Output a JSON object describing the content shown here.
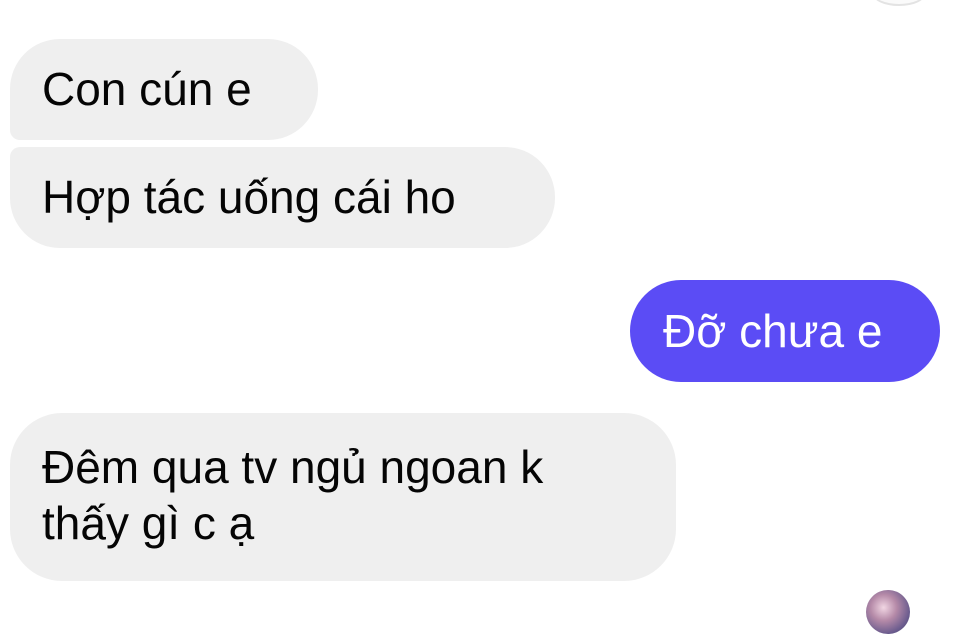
{
  "conversation": {
    "messages": [
      {
        "direction": "incoming",
        "text": "Con cún e"
      },
      {
        "direction": "incoming",
        "text": "Hợp tác uống cái ho"
      },
      {
        "direction": "outgoing",
        "text": "Đỡ chưa e"
      },
      {
        "direction": "incoming",
        "lines": [
          "Đêm qua tv ngủ ngoan k",
          "thấy gì c ạ"
        ]
      }
    ]
  },
  "colors": {
    "incoming_bubble": "#efefef",
    "outgoing_bubble": "#5b4cf5",
    "incoming_text": "#050505",
    "outgoing_text": "#ffffff"
  },
  "icons": {
    "top_avatar": "avatar-icon",
    "bottom_avatar": "avatar-icon"
  }
}
